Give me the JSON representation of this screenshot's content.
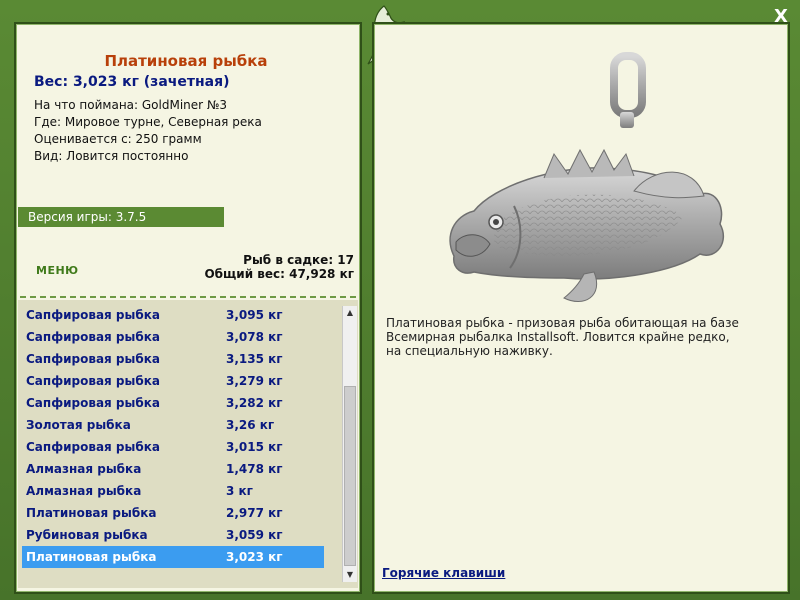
{
  "close_label": "X",
  "fish": {
    "title": "Платиновая рыбка",
    "weight_line": "Вес: 3,023 кг (зачетная)",
    "caught_with": "На что поймана: GoldMiner №3",
    "where": "Где: Мировое турне, Северная река",
    "rated_from": "Оценивается с: 250 грамм",
    "kind": "Вид: Ловится постоянно",
    "description": "Платиновая рыбка - призовая рыба обитающая на базе Всемирная рыбалка Installsoft. Ловится крайне редко, на специальную наживку."
  },
  "version": "Версия игры: 3.7.5",
  "menu_label": "МЕНЮ",
  "stats": {
    "cage_count": "Рыб в садке: 17",
    "total_weight": "Общий вес: 47,928 кг"
  },
  "catch_list": [
    {
      "name": "Сапфировая рыбка",
      "weight": "3,095 кг"
    },
    {
      "name": "Сапфировая рыбка",
      "weight": "3,078 кг"
    },
    {
      "name": "Сапфировая рыбка",
      "weight": "3,135 кг"
    },
    {
      "name": "Сапфировая рыбка",
      "weight": "3,279 кг"
    },
    {
      "name": "Сапфировая рыбка",
      "weight": "3,282 кг"
    },
    {
      "name": "Золотая рыбка",
      "weight": "3,26 кг"
    },
    {
      "name": "Сапфировая рыбка",
      "weight": "3,015 кг"
    },
    {
      "name": "Алмазная рыбка",
      "weight": "1,478 кг"
    },
    {
      "name": "Алмазная рыбка",
      "weight": "3 кг"
    },
    {
      "name": "Платиновая рыбка",
      "weight": "2,977 кг"
    },
    {
      "name": "Рубиновая рыбка",
      "weight": "3,059 кг"
    },
    {
      "name": "Платиновая рыбка",
      "weight": "3,023 кг"
    }
  ],
  "selected_index": 11,
  "hotkeys_label": "Горячие клавиши",
  "colors": {
    "frame": "#4f7a2e",
    "panel": "#f5f5e3",
    "title": "#b8400a",
    "list_text": "#0a1a80",
    "selected": "#3b9cf0"
  }
}
